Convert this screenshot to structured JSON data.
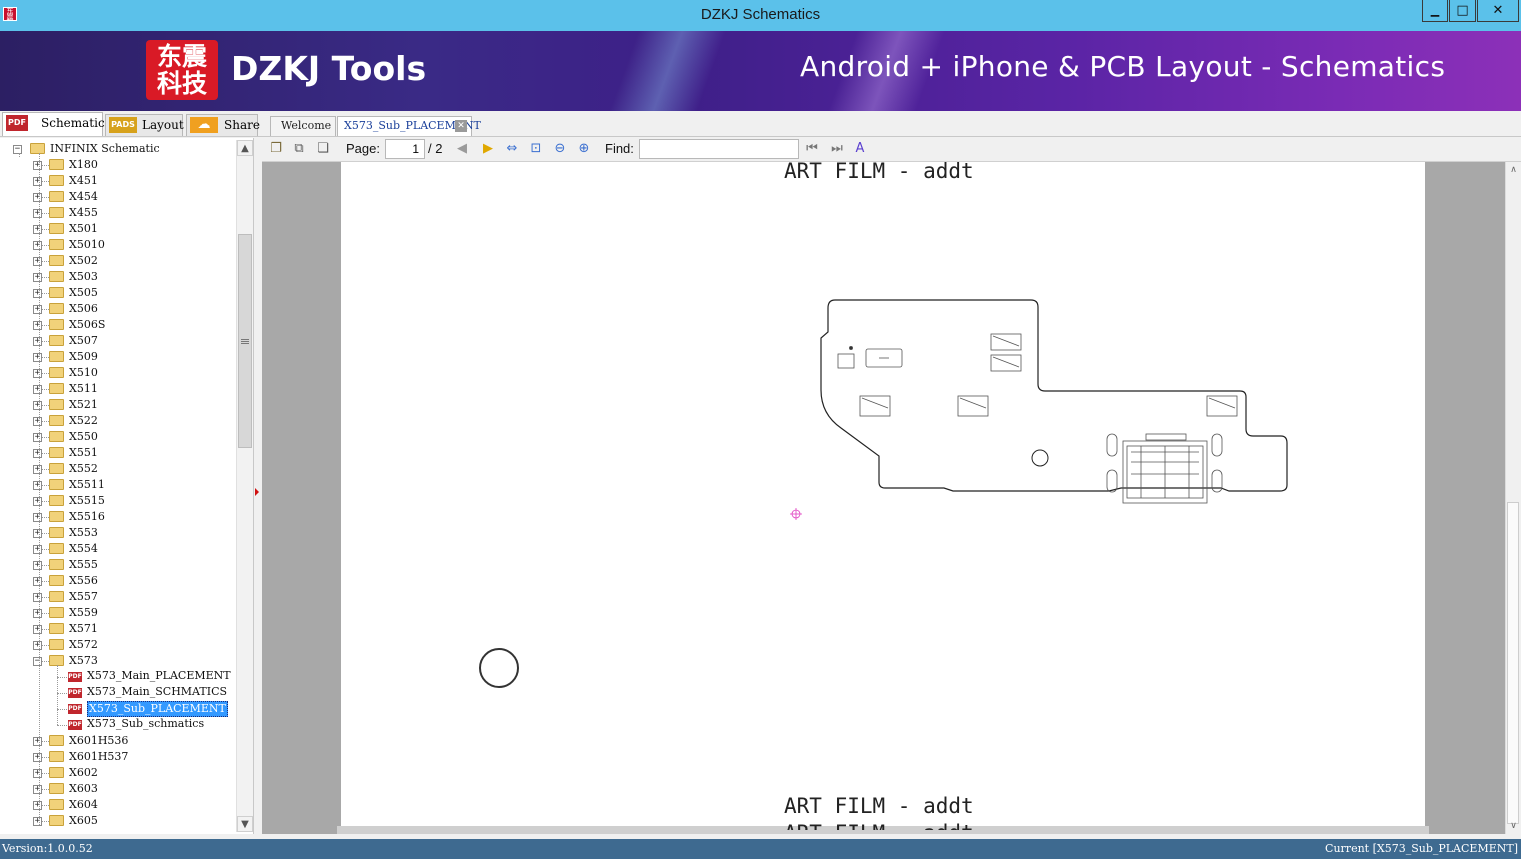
{
  "window": {
    "title": "DZKJ Schematics",
    "app_icon_text": "东震科技",
    "controls": {
      "minimize": "▁",
      "maximize": "□",
      "close": "✕"
    }
  },
  "banner": {
    "logo_text": "东震科技",
    "brand": "DZKJ Tools",
    "tagline": "Android + iPhone & PCB Layout - Schematics"
  },
  "left_tabs": [
    {
      "icon_text": "PDF",
      "label": "Schematic",
      "active": true
    },
    {
      "icon_text": "PADS",
      "label": "Layout",
      "active": false
    },
    {
      "icon_text": "☁",
      "label": "Share",
      "active": false
    }
  ],
  "doc_tabs": [
    {
      "label": "Welcome",
      "active": false
    },
    {
      "label": "X573_Sub_PLACEMENT",
      "active": true,
      "close": "✕"
    }
  ],
  "tree": {
    "root": "INFINIX Schematic",
    "folders_before": [
      "X180",
      "X451",
      "X454",
      "X455",
      "X501",
      "X5010",
      "X502",
      "X503",
      "X505",
      "X506",
      "X506S",
      "X507",
      "X509",
      "X510",
      "X511",
      "X521",
      "X522",
      "X550",
      "X551",
      "X552",
      "X5511",
      "X5515",
      "X5516",
      "X553",
      "X554",
      "X555",
      "X556",
      "X557",
      "X559",
      "X571",
      "X572"
    ],
    "expanded_folder": "X573",
    "expanded_files": [
      {
        "name": "X573_Main_PLACEMENT",
        "selected": false
      },
      {
        "name": "X573_Main_SCHMATICS",
        "selected": false
      },
      {
        "name": "X573_Sub_PLACEMENT",
        "selected": true
      },
      {
        "name": "X573_Sub_schmatics",
        "selected": false
      }
    ],
    "folders_after": [
      "X601H536",
      "X601H537",
      "X602",
      "X603",
      "X604",
      "X605"
    ],
    "pdf_icon_text": "PDF"
  },
  "toolbar": {
    "page_label": "Page:",
    "page_current": "1",
    "page_total": "/ 2",
    "find_label": "Find:",
    "find_value": "",
    "icons": [
      "copy-icon",
      "copy-page-icon",
      "paste-icon",
      "prev-page-icon",
      "next-page-icon",
      "fit-width-icon",
      "fit-page-icon",
      "zoom-out-icon",
      "zoom-in-icon",
      "find-prev-icon",
      "find-next-icon",
      "highlight-icon"
    ]
  },
  "document": {
    "header": "ART FILM - addt",
    "footer": "ART FILM - addt",
    "next_page_peek": "ART FILM - addt"
  },
  "status": {
    "version": "Version:1.0.0.52",
    "current": "Current [X573_Sub_PLACEMENT]"
  },
  "colors": {
    "titlebar": "#5bc1ea",
    "statusbar": "#3e6a90",
    "selection": "#3399ff",
    "banner_start": "#2c1f63",
    "banner_end": "#8c30b8"
  }
}
